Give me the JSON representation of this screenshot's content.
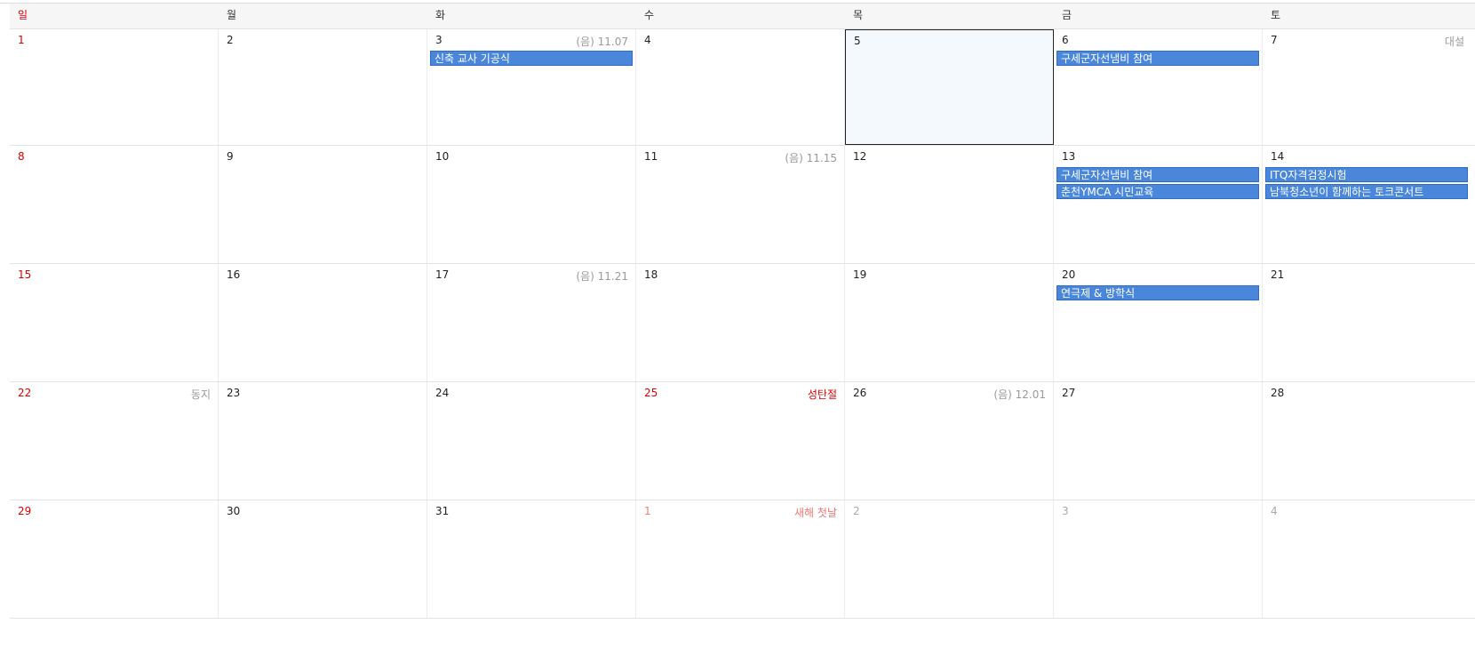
{
  "weekdays": [
    "일",
    "월",
    "화",
    "수",
    "목",
    "금",
    "토"
  ],
  "weeks": [
    [
      {
        "num": "1",
        "red": true
      },
      {
        "num": "2"
      },
      {
        "num": "3",
        "side": "(음) 11.07",
        "events": [
          "신축 교사 기공식"
        ]
      },
      {
        "num": "4"
      },
      {
        "num": "5",
        "today": true
      },
      {
        "num": "6",
        "events": [
          "구세군자선냄비 참여"
        ]
      },
      {
        "num": "7",
        "side": "대설"
      }
    ],
    [
      {
        "num": "8",
        "red": true
      },
      {
        "num": "9"
      },
      {
        "num": "10"
      },
      {
        "num": "11",
        "side": "(음) 11.15"
      },
      {
        "num": "12"
      },
      {
        "num": "13",
        "events": [
          "구세군자선냄비 참여",
          "춘천YMCA 시민교육"
        ]
      },
      {
        "num": "14",
        "events": [
          "ITQ자격검정시험",
          "남북청소년이 함께하는 토크콘서트"
        ]
      }
    ],
    [
      {
        "num": "15",
        "red": true
      },
      {
        "num": "16"
      },
      {
        "num": "17",
        "side": "(음) 11.21"
      },
      {
        "num": "18"
      },
      {
        "num": "19"
      },
      {
        "num": "20",
        "events": [
          "연극제 & 방학식"
        ]
      },
      {
        "num": "21"
      }
    ],
    [
      {
        "num": "22",
        "red": true,
        "side": "동지"
      },
      {
        "num": "23"
      },
      {
        "num": "24"
      },
      {
        "num": "25",
        "red": true,
        "side": "성탄절",
        "holiday": true
      },
      {
        "num": "26",
        "side": "(음) 12.01"
      },
      {
        "num": "27"
      },
      {
        "num": "28"
      }
    ],
    [
      {
        "num": "29",
        "red": true
      },
      {
        "num": "30"
      },
      {
        "num": "31"
      },
      {
        "num": "1",
        "red": true,
        "other": true,
        "side": "새해 첫날",
        "holiday": true
      },
      {
        "num": "2",
        "other": true
      },
      {
        "num": "3",
        "other": true
      },
      {
        "num": "4",
        "other": true
      }
    ]
  ],
  "colors": {
    "event_bg": "#4a87da",
    "sunday": "#dd0000",
    "today_bg": "#f4f9fd"
  }
}
